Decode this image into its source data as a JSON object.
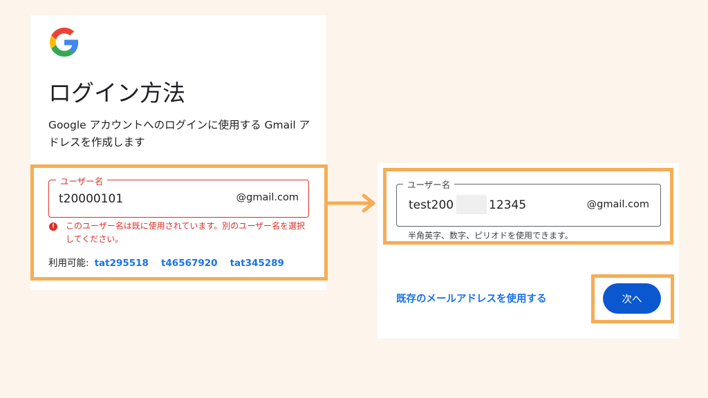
{
  "left": {
    "title": "ログイン方法",
    "description": "Google アカウントへのログインに使用する Gmail アドレスを作成します",
    "field": {
      "label": "ユーザー名",
      "value": "t20000101",
      "suffix": "@gmail.com"
    },
    "error": {
      "icon": "!",
      "text": "このユーザー名は既に使用されています。別のユーザー名を選択してください。"
    },
    "available": {
      "label": "利用可能:",
      "options": [
        "tat295518",
        "t46567920",
        "tat345289"
      ]
    }
  },
  "right": {
    "field": {
      "label": "ユーザー名",
      "value_prefix": "test200",
      "value_suffix": "12345",
      "suffix": "@gmail.com"
    },
    "hint": "半角英字、数字、ピリオドを使用できます。",
    "existing_link": "既存のメールアドレスを使用する",
    "next_button": "次へ"
  },
  "colors": {
    "background": "#fdf4ec",
    "highlight": "#f6ad54",
    "error": "#d93025",
    "link": "#1a73e8",
    "primary_button": "#0b57d0"
  }
}
